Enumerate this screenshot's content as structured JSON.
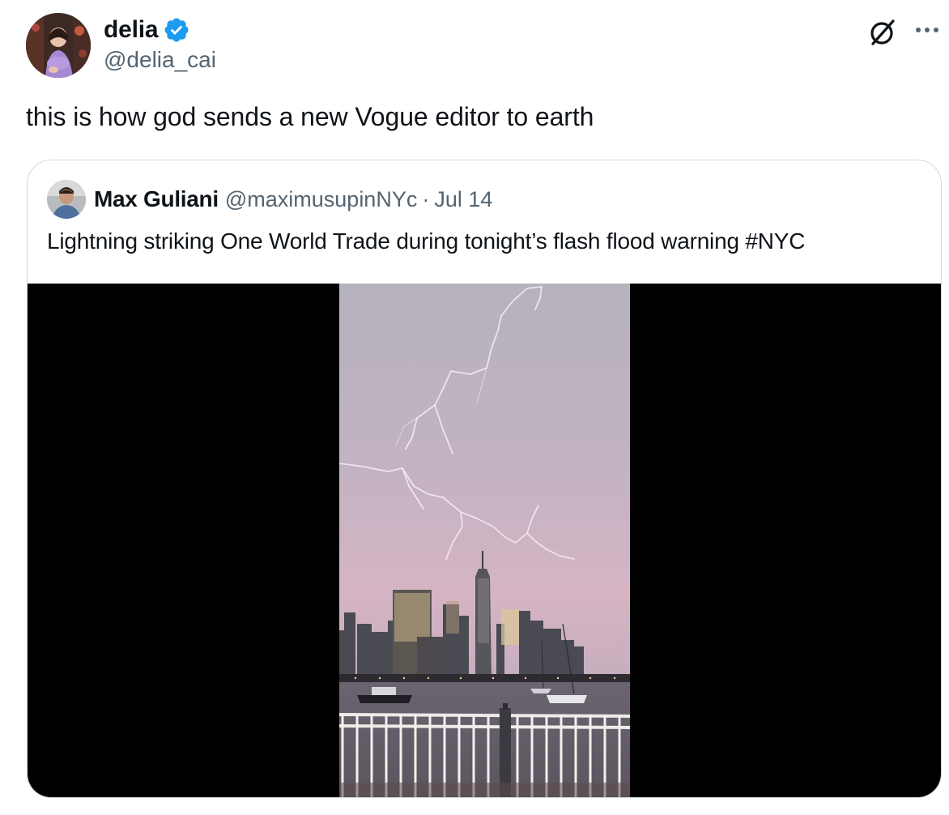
{
  "tweet": {
    "author_name": "delia",
    "author_handle": "@delia_cai",
    "text": "this is how god sends a new Vogue editor to earth",
    "verified_color": "#1d9bf0",
    "icons": [
      "verified-badge-icon",
      "grok-icon",
      "more-icon"
    ]
  },
  "quote": {
    "author_name": "Max Guliani",
    "author_handle": "@maximusupinNYc",
    "separator": "·",
    "date": "Jul 14",
    "text": "Lightning striking One World Trade during tonight’s flash flood warning #NYC"
  },
  "colors": {
    "text_primary": "#0f1419",
    "text_secondary": "#536471",
    "border": "#cfd9de"
  }
}
